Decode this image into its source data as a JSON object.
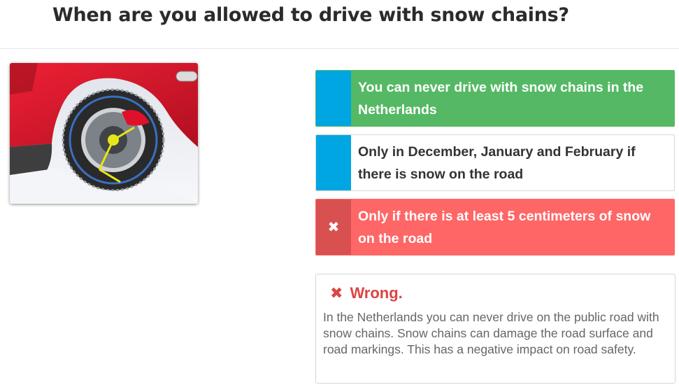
{
  "question": {
    "title": "When are you allowed to drive with snow chains?"
  },
  "image": {
    "icon": "car-wheel-with-snow-chains",
    "colors": {
      "car": "#d8142a",
      "chain_tensioner": "#e6e616",
      "snow": "#f1f3f6"
    }
  },
  "answers": [
    {
      "text": "You can never drive with snow chains in the Netherlands",
      "state": "correct",
      "marker": ""
    },
    {
      "text": "Only in December, January and February if there is snow on the road",
      "state": "neutral",
      "marker": ""
    },
    {
      "text": "Only if there is at least 5 centimeters of snow on the road",
      "state": "wrong",
      "marker": "✖"
    }
  ],
  "feedback": {
    "icon": "✖",
    "title": "Wrong.",
    "text": "In the Netherlands you can never drive on the public road with snow chains. Snow chains can damage the road surface and road markings. This has a negative impact on road safety."
  },
  "colors": {
    "correct": "#55b864",
    "wrong": "#ff6666",
    "wrong_marker": "#d95050",
    "marker": "#00a6e2",
    "error_text": "#dd4444"
  }
}
